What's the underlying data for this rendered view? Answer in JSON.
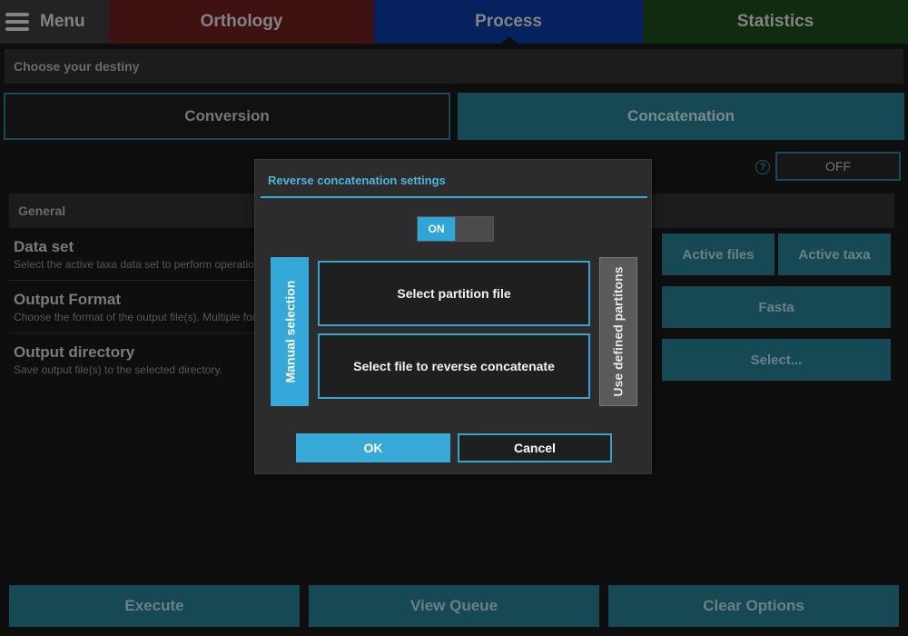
{
  "topbar": {
    "menu_label": "Menu",
    "tabs": [
      {
        "label": "Orthology",
        "color": "#4a1616"
      },
      {
        "label": "Process",
        "color": "#08286f"
      },
      {
        "label": "Statistics",
        "color": "#133313"
      }
    ]
  },
  "process": {
    "destiny_label": "Choose your destiny",
    "conversion_label": "Conversion",
    "concatenation_label": "Concatenation",
    "reverse_toggle_value": "OFF",
    "help_icon_glyph": "?",
    "general_label": "General",
    "settings": [
      {
        "title": "Data set",
        "description": "Select the active taxa data set to perform operations"
      },
      {
        "title": "Output Format",
        "description": "Choose the format of the output file(s). Multiple formats"
      },
      {
        "title": "Output directory",
        "description": "Save output file(s) to the selected directory."
      }
    ],
    "buttons": {
      "active_files": "Active files",
      "active_taxa": "Active taxa",
      "format": "Fasta",
      "select_dir": "Select..."
    }
  },
  "bottom": {
    "execute": "Execute",
    "view_queue": "View Queue",
    "clear_options": "Clear Options"
  },
  "dialog": {
    "title": "Reverse concatenation settings",
    "switch_label": "ON",
    "manual_selection": "Manual selection",
    "use_defined_partitions": "Use defined partitons",
    "select_partition_file": "Select partition file",
    "select_reverse_file": "Select file to reverse concatenate",
    "ok": "OK",
    "cancel": "Cancel",
    "accent_color": "#36a9d8"
  }
}
